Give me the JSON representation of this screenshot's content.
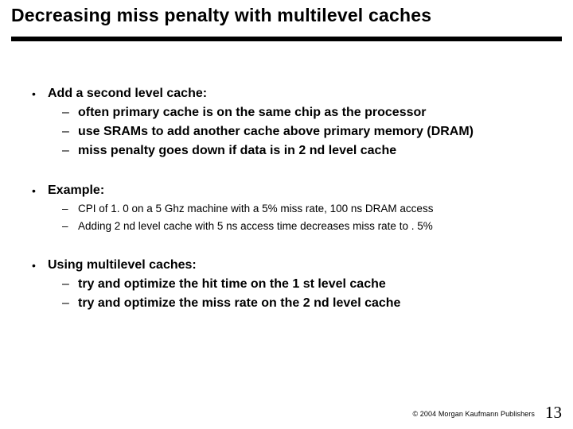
{
  "title": "Decreasing miss penalty with multilevel caches",
  "sections": [
    {
      "head": "Add a second level cache:",
      "bold": true,
      "items_bold": true,
      "items": [
        "often primary cache is on the same chip as the processor",
        "use SRAMs to add another cache above primary memory (DRAM)",
        "miss penalty goes down if data is in 2 nd level cache"
      ]
    },
    {
      "head": "Example:",
      "bold": true,
      "items_bold": false,
      "items": [
        "CPI of 1. 0 on a 5 Ghz machine with a 5% miss rate, 100 ns DRAM access",
        "Adding 2 nd level cache with 5 ns access time decreases miss rate to . 5%"
      ]
    },
    {
      "head": "Using multilevel caches:",
      "bold": true,
      "items_bold": true,
      "items": [
        "try and optimize the hit time on the 1 st level cache",
        "try and optimize the miss rate on the 2 nd level cache"
      ]
    }
  ],
  "footer": {
    "copyright": "© 2004 Morgan Kaufmann Publishers",
    "page": "13"
  }
}
